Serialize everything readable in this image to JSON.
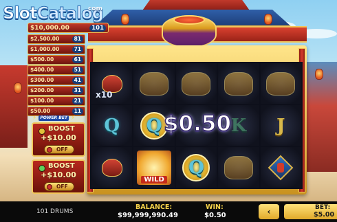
{
  "logo": {
    "slot": "Slot",
    "catalog": "Catalog",
    "sup": "com"
  },
  "ladder": {
    "rows": [
      {
        "prize": "$10,000.00",
        "count": "101"
      },
      {
        "prize": "$2,500.00",
        "count": "81"
      },
      {
        "prize": "$1,000.00",
        "count": "71"
      },
      {
        "prize": "$500.00",
        "count": "61"
      },
      {
        "prize": "$400.00",
        "count": "51"
      },
      {
        "prize": "$300.00",
        "count": "41"
      },
      {
        "prize": "$200.00",
        "count": "31"
      },
      {
        "prize": "$100.00",
        "count": "21"
      },
      {
        "prize": "$50.00",
        "count": "11"
      }
    ]
  },
  "power_bet": {
    "line1": "POWER",
    "line2": "BET"
  },
  "boosts": [
    {
      "title": "BOOST",
      "amount": "+$10.00",
      "state": "OFF",
      "indicator_color": "#e0c23a"
    },
    {
      "title": "BOOST",
      "amount": "+$10.00",
      "state": "OFF",
      "indicator_color": "#5fd35a"
    }
  ],
  "reels": {
    "symbols": [
      [
        "fortune-x10",
        "bull",
        "bull",
        "bull",
        "bull"
      ],
      [
        "Q",
        "Q-coin",
        "",
        "K",
        "J"
      ],
      [
        "fortune",
        "wild",
        "Q-coin",
        "bull",
        "diamond"
      ]
    ],
    "multiplier": "x10",
    "wild_label": "WILD"
  },
  "win_overlay": "$0.50",
  "bottom": {
    "game_name": "101 DRUMS",
    "balance_label": "BALANCE:",
    "balance_value": "$99,999,990.49",
    "win_label": "WIN:",
    "win_value": "$0.50",
    "back_label": "‹",
    "bet_label": "BET:",
    "bet_value": "$5.00"
  },
  "colors": {
    "accent_gold": "#f1c65a",
    "frame_red": "#b7281d",
    "bar_bg": "#0a0a0a"
  }
}
